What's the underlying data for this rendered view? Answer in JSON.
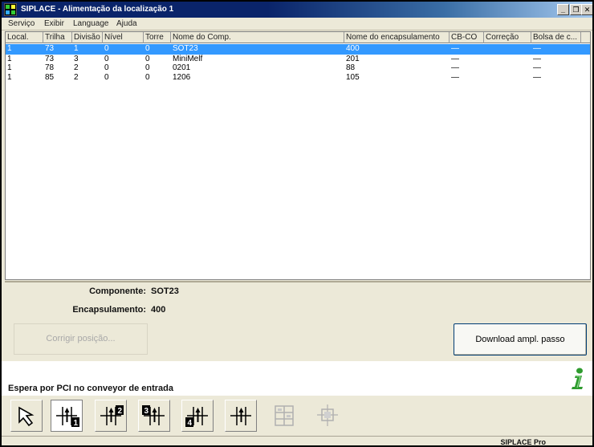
{
  "window": {
    "title": "SIPLACE - Alimentação da localização 1",
    "min_glyph": "_",
    "max_glyph": "❐",
    "close_glyph": "✕"
  },
  "menu": [
    "Serviço",
    "Exibir",
    "Language",
    "Ajuda"
  ],
  "table": {
    "columns": [
      "Local.",
      "Trilha",
      "Divisão",
      "Nível",
      "Torre",
      "Nome do Comp.",
      "Nome do encapsulamento",
      "CB-CO",
      "Correção",
      "Bolsa de c..."
    ],
    "rows": [
      [
        "1",
        "73",
        "1",
        "0",
        "0",
        "SOT23",
        "400",
        "—",
        "",
        "—"
      ],
      [
        "1",
        "73",
        "3",
        "0",
        "0",
        "MiniMelf",
        "201",
        "—",
        "",
        "—"
      ],
      [
        "1",
        "78",
        "2",
        "0",
        "0",
        "0201",
        "88",
        "—",
        "",
        "—"
      ],
      [
        "1",
        "85",
        "2",
        "0",
        "0",
        "1206",
        "105",
        "—",
        "",
        "—"
      ]
    ],
    "selected_row": 0
  },
  "details": {
    "component_label": "Componente:",
    "component_value": "SOT23",
    "package_label": "Encapsulamento:",
    "package_value": "400"
  },
  "buttons": {
    "correct_position": "Corrigir posição...",
    "download_step": "Download ampl. passo"
  },
  "status": {
    "message": "Espera por PCI no conveyor de entrada",
    "product": "SIPLACE Pro"
  },
  "toolbar_tools": [
    {
      "icon": "arrow-pointer-icon",
      "state": "raised"
    },
    {
      "icon": "track-1-icon",
      "label": "1",
      "state": "active"
    },
    {
      "icon": "track-2-icon",
      "label": "2",
      "state": "raised"
    },
    {
      "icon": "track-3-icon",
      "label": "3",
      "state": "raised"
    },
    {
      "icon": "track-4-icon",
      "label": "4",
      "state": "raised"
    },
    {
      "icon": "track-all-icon",
      "state": "raised"
    },
    {
      "icon": "grid-disabled-icon",
      "state": "disabled"
    },
    {
      "icon": "target-disabled-icon",
      "state": "disabled"
    }
  ],
  "colors": {
    "selection": "#3399ff",
    "title_gradient_start": "#0a246a",
    "info_icon": "#2e9b2e"
  }
}
